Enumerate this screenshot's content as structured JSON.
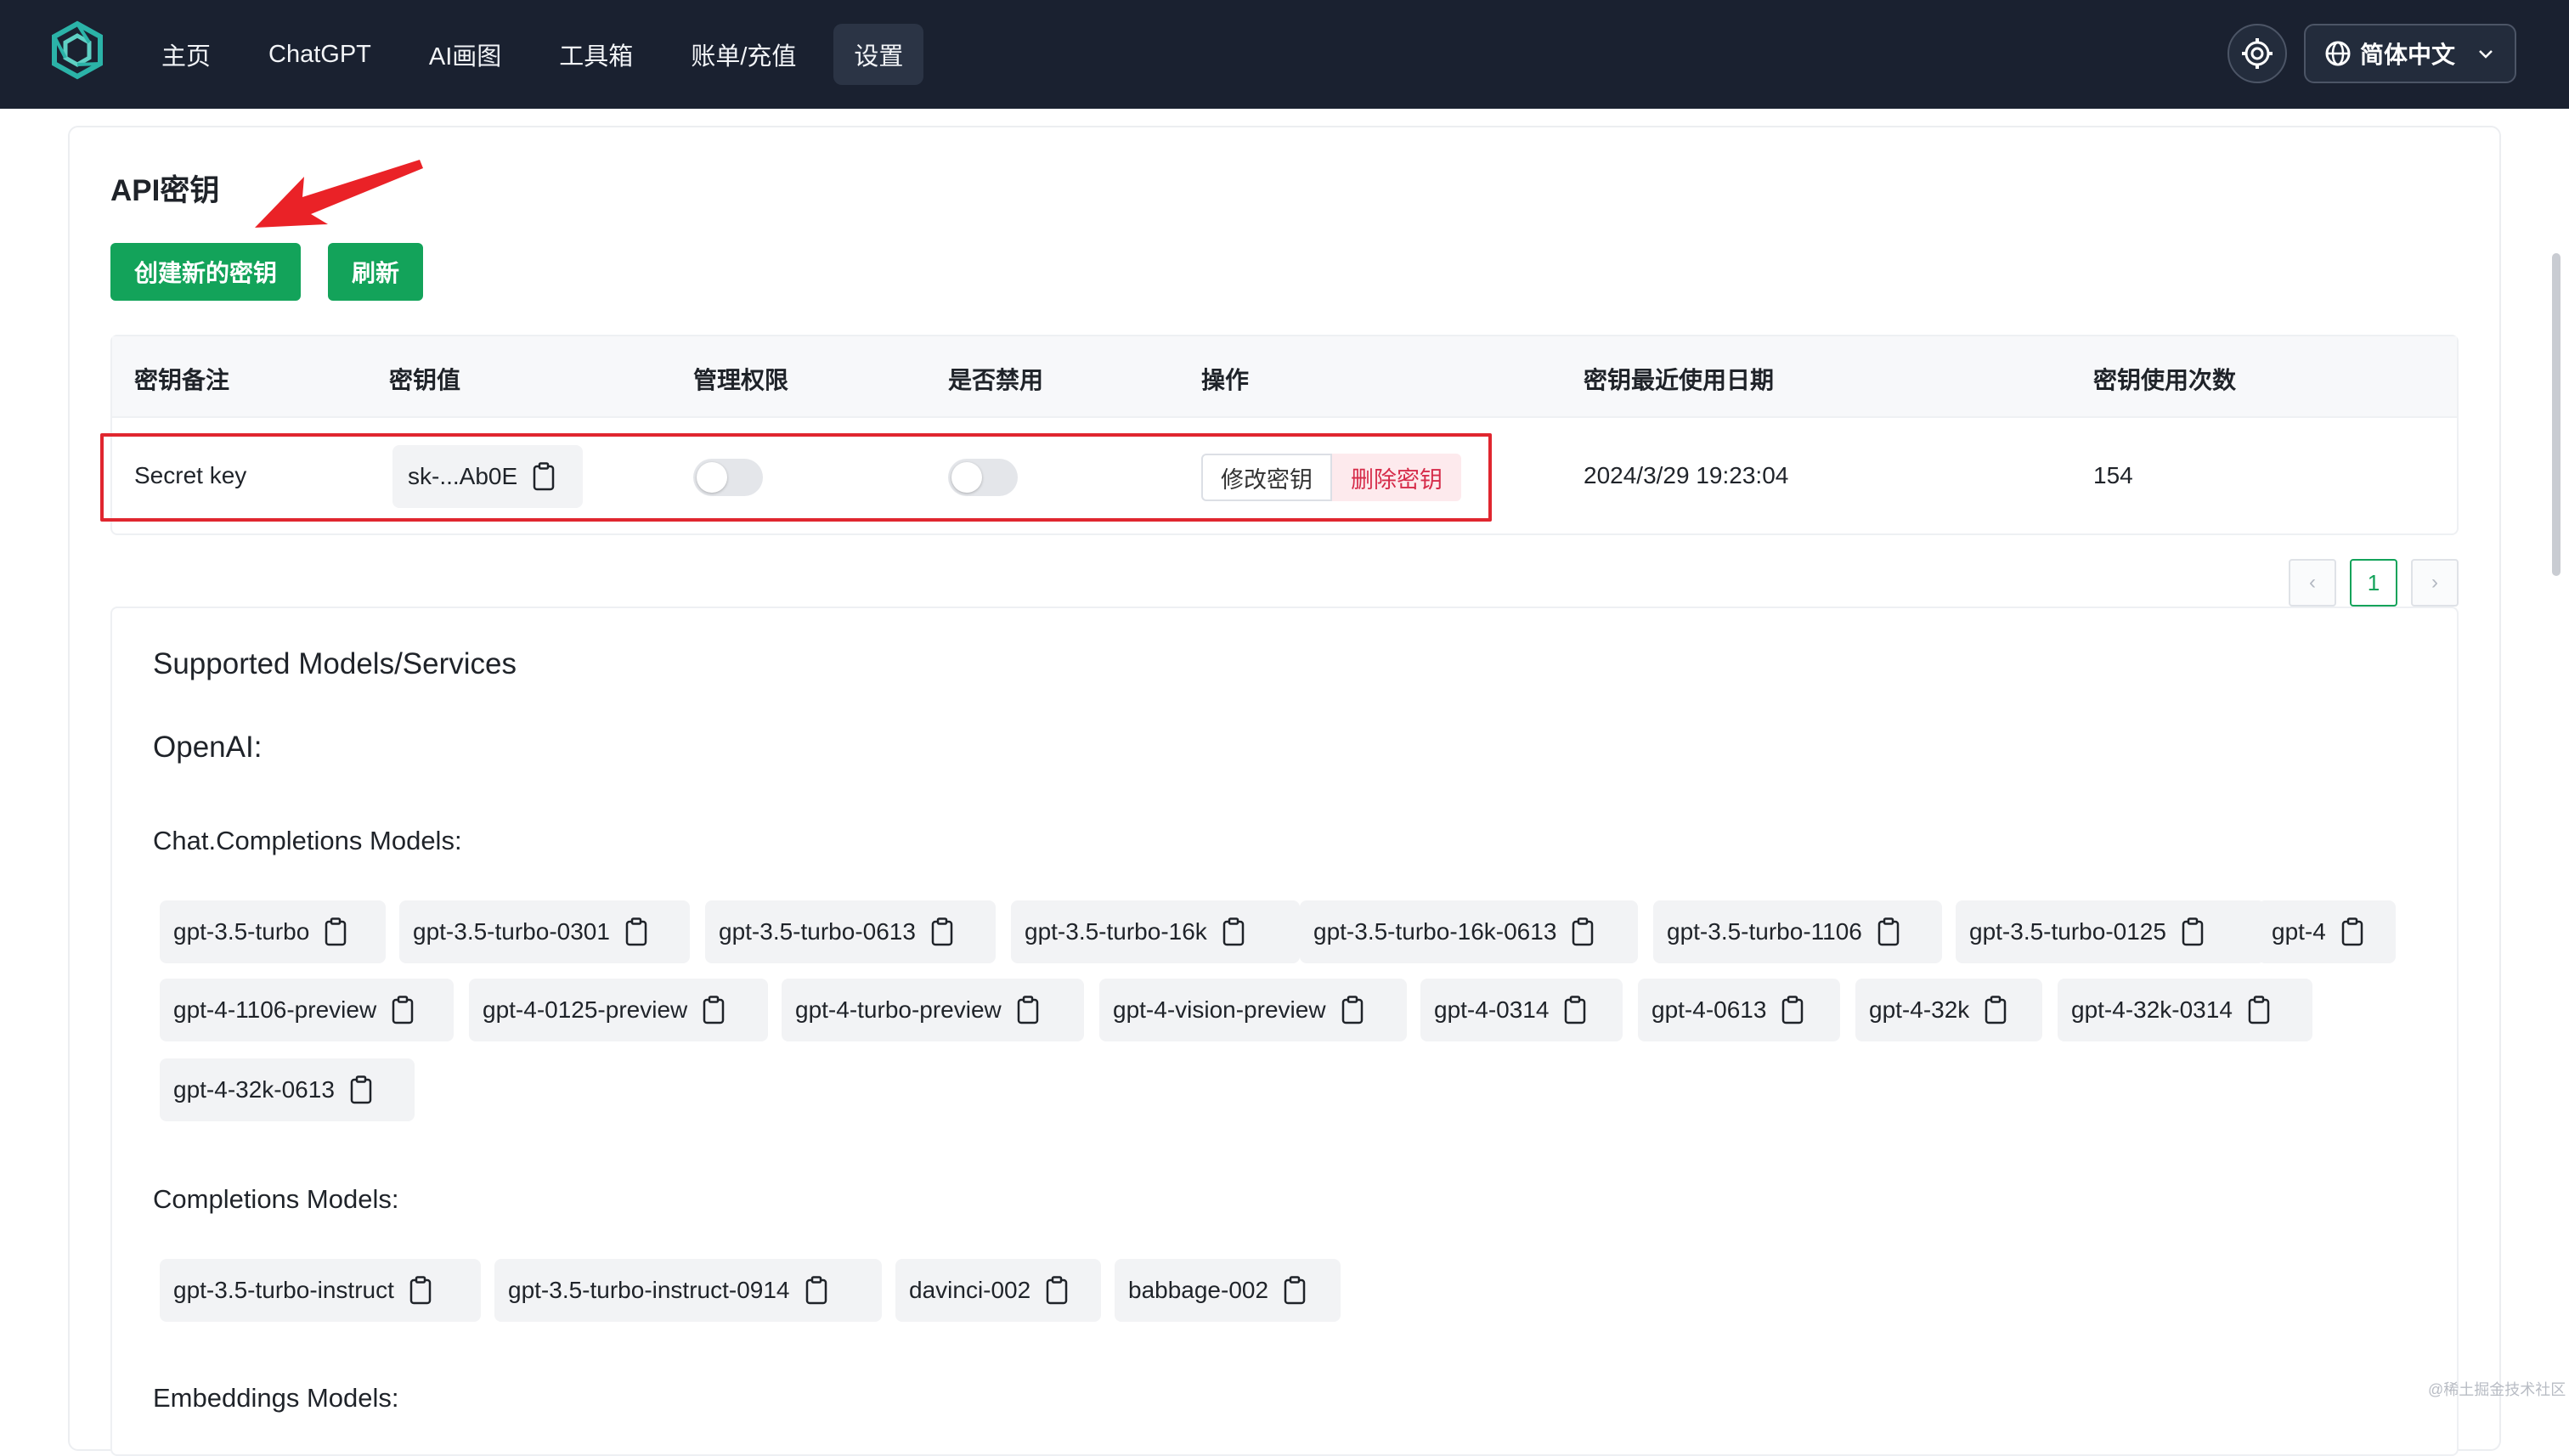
{
  "nav": {
    "items": [
      {
        "label": "主页"
      },
      {
        "label": "ChatGPT"
      },
      {
        "label": "AI画图"
      },
      {
        "label": "工具箱"
      },
      {
        "label": "账单/充值"
      },
      {
        "label": "设置"
      }
    ],
    "active": "设置",
    "language": "简体中文",
    "icons": [
      "logo-icon",
      "theme-gear-icon",
      "globe-icon",
      "chevron-down-icon"
    ]
  },
  "api": {
    "title": "API密钥",
    "create_button": "创建新的密钥",
    "refresh_button": "刷新",
    "columns": [
      "密钥备注",
      "密钥值",
      "管理权限",
      "是否禁用",
      "操作",
      "密钥最近使用日期",
      "密钥使用次数"
    ],
    "row": {
      "note": "Secret key",
      "key_value": "sk-...Ab0E",
      "admin_enabled": false,
      "disabled": false,
      "edit_button": "修改密钥",
      "delete_button": "删除密钥",
      "last_used": "2024/3/29 19:23:04",
      "usage_count": "154"
    },
    "pagination": {
      "prev": "‹",
      "current": "1",
      "next": "›"
    }
  },
  "models": {
    "title": "Supported Models/Services",
    "provider": "OpenAI:",
    "chat_heading": "Chat.Completions Models:",
    "chat": [
      "gpt-3.5-turbo",
      "gpt-3.5-turbo-0301",
      "gpt-3.5-turbo-0613",
      "gpt-3.5-turbo-16k",
      "gpt-3.5-turbo-16k-0613",
      "gpt-3.5-turbo-1106",
      "gpt-3.5-turbo-0125",
      "gpt-4",
      "gpt-4-1106-preview",
      "gpt-4-0125-preview",
      "gpt-4-turbo-preview",
      "gpt-4-vision-preview",
      "gpt-4-0314",
      "gpt-4-0613",
      "gpt-4-32k",
      "gpt-4-32k-0314",
      "gpt-4-32k-0613"
    ],
    "completions_heading": "Completions Models:",
    "completions": [
      "gpt-3.5-turbo-instruct",
      "gpt-3.5-turbo-instruct-0914",
      "davinci-002",
      "babbage-002"
    ],
    "embeddings_heading": "Embeddings Models:"
  },
  "watermark": "@稀土掘金技术社区",
  "colors": {
    "navbar": "#1a2130",
    "accent_green": "#13a35a",
    "danger_red": "#d62c4a",
    "highlight_red": "#e0262f"
  }
}
